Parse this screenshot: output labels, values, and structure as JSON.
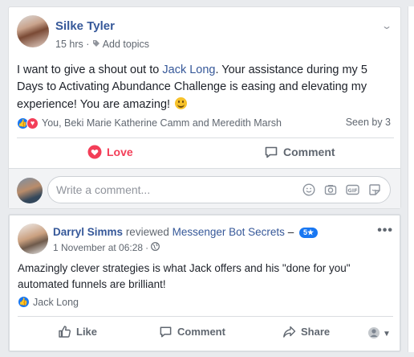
{
  "post1": {
    "author": "Silke Tyler",
    "time": "15 hrs",
    "separator": "·",
    "add_topics": "Add topics",
    "text_parts": [
      "I want to give a shout out to ",
      "Jack Long",
      ". Your assistance during my 5 Days to Activating Abundance Challenge is easing and elevating my experience! You are amazing!"
    ],
    "reactors": "You, Beki Marie Katherine Camm and Meredith Marsh",
    "seen_by": "Seen by 3",
    "love_label": "Love",
    "comment_label": "Comment",
    "composer_placeholder": "Write a comment...",
    "icons": [
      "like-reaction-icon",
      "love-reaction-icon",
      "tag-icon",
      "chevron-down-icon",
      "smile-icon",
      "camera-icon",
      "gif-icon",
      "sticker-icon",
      "heart-icon",
      "comment-icon"
    ]
  },
  "post2": {
    "author": "Darryl Simms",
    "verb": "reviewed",
    "page": "Messenger Bot Secrets",
    "dash": "–",
    "rating": "5★",
    "date": "1 November at 06:28",
    "separator": "·",
    "text": "Amazingly clever strategies is what Jack offers and his \"done for you\" automated funnels are brilliant!",
    "liker": "Jack Long",
    "like_label": "Like",
    "comment_label": "Comment",
    "share_label": "Share",
    "more": "•••"
  },
  "colors": {
    "link": "#365899",
    "love": "#f33e58",
    "like": "#1877f2",
    "muted": "#606770"
  }
}
